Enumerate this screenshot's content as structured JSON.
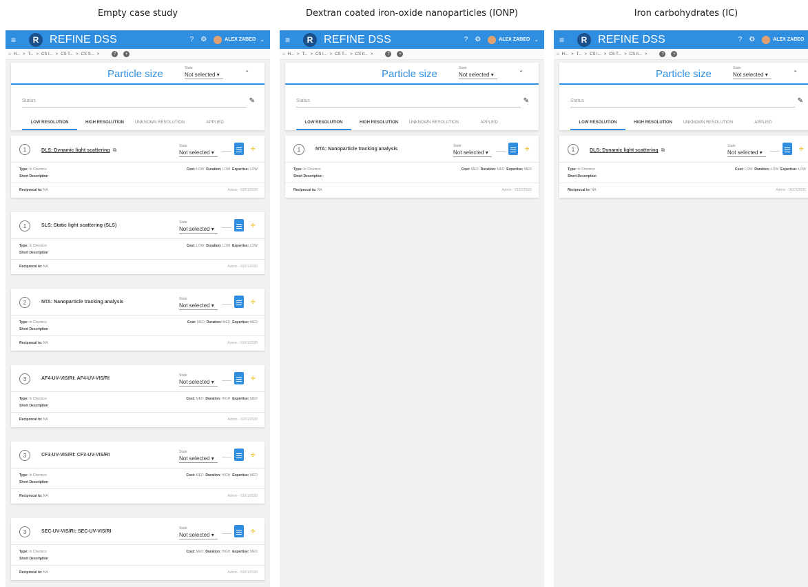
{
  "panels": [
    {
      "title": "Empty case study",
      "methods": [
        {
          "number": "1",
          "name": "DLS: Dynamic light scattering",
          "link": true,
          "type": "In Chemico",
          "cost": "LOW",
          "duration": "LOW",
          "expertise": "LOW"
        },
        {
          "number": "1",
          "name": "SLS: Static light scattering (SLS)",
          "link": false,
          "type": "In Chemico",
          "cost": "LOW",
          "duration": "LOW",
          "expertise": "LOW"
        },
        {
          "number": "2",
          "name": "NTA: Nanoparticle tracking analysis",
          "link": false,
          "type": "In Chemico",
          "cost": "MED",
          "duration": "MED",
          "expertise": "MED"
        },
        {
          "number": "3",
          "name": "AF4-UV-VIS/RI: AF4-UV-VIS/RI",
          "link": false,
          "type": "In Chemico",
          "cost": "MED",
          "duration": "HIGH",
          "expertise": "MED"
        },
        {
          "number": "3",
          "name": "CF3-UV-VIS/RI: CF3-UV-VIS/RI",
          "link": false,
          "type": "In Chemico",
          "cost": "MED",
          "duration": "HIGH",
          "expertise": "MED"
        },
        {
          "number": "3",
          "name": "SEC-UV-VIS/RI: SEC-UV-VIS/RI",
          "link": false,
          "type": "In Chemico",
          "cost": "MED",
          "duration": "HIGH",
          "expertise": "MED"
        }
      ]
    },
    {
      "title": "Dextran coated iron-oxide nanoparticles (IONP)",
      "methods": [
        {
          "number": "1",
          "name": "NTA: Nanoparticle tracking analysis",
          "link": false,
          "type": "In Chemico",
          "cost": "MED",
          "duration": "MED",
          "expertise": "MED"
        }
      ]
    },
    {
      "title": "Iron carbohydrates (IC)",
      "methods": [
        {
          "number": "1",
          "name": "DLS: Dynamic light scattering",
          "link": true,
          "type": "In Chemico",
          "cost": "LOW",
          "duration": "LOW",
          "expertise": "LOW"
        }
      ]
    }
  ],
  "app": {
    "name": "REFINE DSS",
    "user": "ALEX ZABEO",
    "logo_letter": "R",
    "breadcrumb": [
      "H...",
      ">",
      "T...",
      ">",
      "CS I...",
      ">",
      "CS T...",
      ">",
      "CS S...",
      ">"
    ]
  },
  "breadcrumb_alt": [
    "H...",
    ">",
    "T...",
    ">",
    "CS I...",
    ">",
    "CS T...",
    ">",
    "CS II...",
    ">"
  ],
  "header": {
    "title": "Particle size",
    "state_label": "State",
    "state_value": "Not selected",
    "status_label": "Status"
  },
  "tabs": [
    "LOW RESOLUTION",
    "HIGH RESOLUTION",
    "UNKNOWN RESOLUTION",
    "APPLIED"
  ],
  "labels": {
    "state": "State",
    "not_selected": "Not selected",
    "type": "Type:",
    "cost": "Cost:",
    "duration": "Duration:",
    "expertise": "Expertise:",
    "short_description": "Short Description",
    "reciprocal": "Reciprocal to:",
    "reciprocal_value": "NA",
    "admin": "Admin - 01/01/2020"
  },
  "colors": {
    "primary": "#2f8ee0",
    "accent": "#f0c020",
    "background": "#f1f1f1"
  }
}
